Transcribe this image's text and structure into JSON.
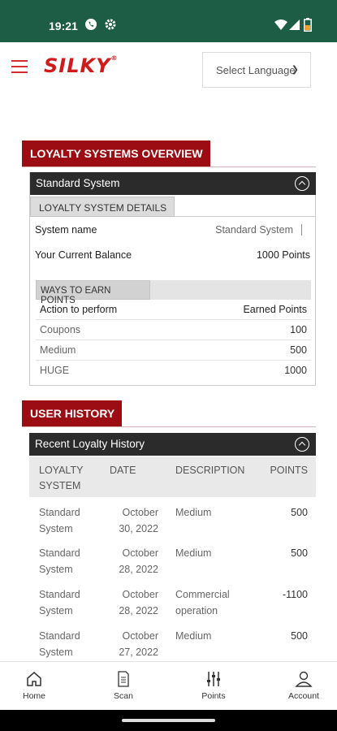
{
  "status_bar": {
    "time": "19:21"
  },
  "header": {
    "logo": "SILKY",
    "logo_mark": "®",
    "language_select": "Select Language"
  },
  "overview": {
    "title": "LOYALTY SYSTEMS OVERVIEW",
    "system_bar": "Standard System",
    "details_tab": "LOYALTY SYSTEM DETAILS",
    "system_name_label": "System name",
    "system_name_value": "Standard System",
    "balance_label": "Your Current Balance",
    "balance_value": "1000 Points",
    "earn_tab": "WAYS TO EARN POINTS",
    "earn_header": {
      "action": "Action to perform",
      "points": "Earned Points"
    },
    "earn_rows": [
      {
        "action": "Coupons",
        "points": "100"
      },
      {
        "action": "Medium",
        "points": "500"
      },
      {
        "action": "HUGE",
        "points": "1000"
      }
    ]
  },
  "history": {
    "title": "USER HISTORY",
    "bar": "Recent Loyalty History",
    "columns": {
      "system1": "LOYALTY",
      "system2": "SYSTEM",
      "date": "DATE",
      "description": "DESCRIPTION",
      "points": "POINTS"
    },
    "rows": [
      {
        "sys1": "Standard",
        "sys2": "System",
        "date1": "October",
        "date2": "30, 2022",
        "desc1": "Medium",
        "desc2": "",
        "points": "500"
      },
      {
        "sys1": "Standard",
        "sys2": "System",
        "date1": "October",
        "date2": "28, 2022",
        "desc1": "Medium",
        "desc2": "",
        "points": "500"
      },
      {
        "sys1": "Standard",
        "sys2": "System",
        "date1": "October",
        "date2": "28, 2022",
        "desc1": "Commercial",
        "desc2": "operation",
        "points": "-1100"
      },
      {
        "sys1": "Standard",
        "sys2": "System",
        "date1": "October",
        "date2": "27, 2022",
        "desc1": "Medium",
        "desc2": "",
        "points": "500"
      }
    ]
  },
  "nav": {
    "home": "Home",
    "scan": "Scan",
    "points": "Points",
    "account": "Account"
  },
  "colors": {
    "status_bar": "#1d5c45",
    "brand_red": "#9b0d12",
    "logo_red": "#d11a1a",
    "dark_bar": "#2b2b2b"
  }
}
